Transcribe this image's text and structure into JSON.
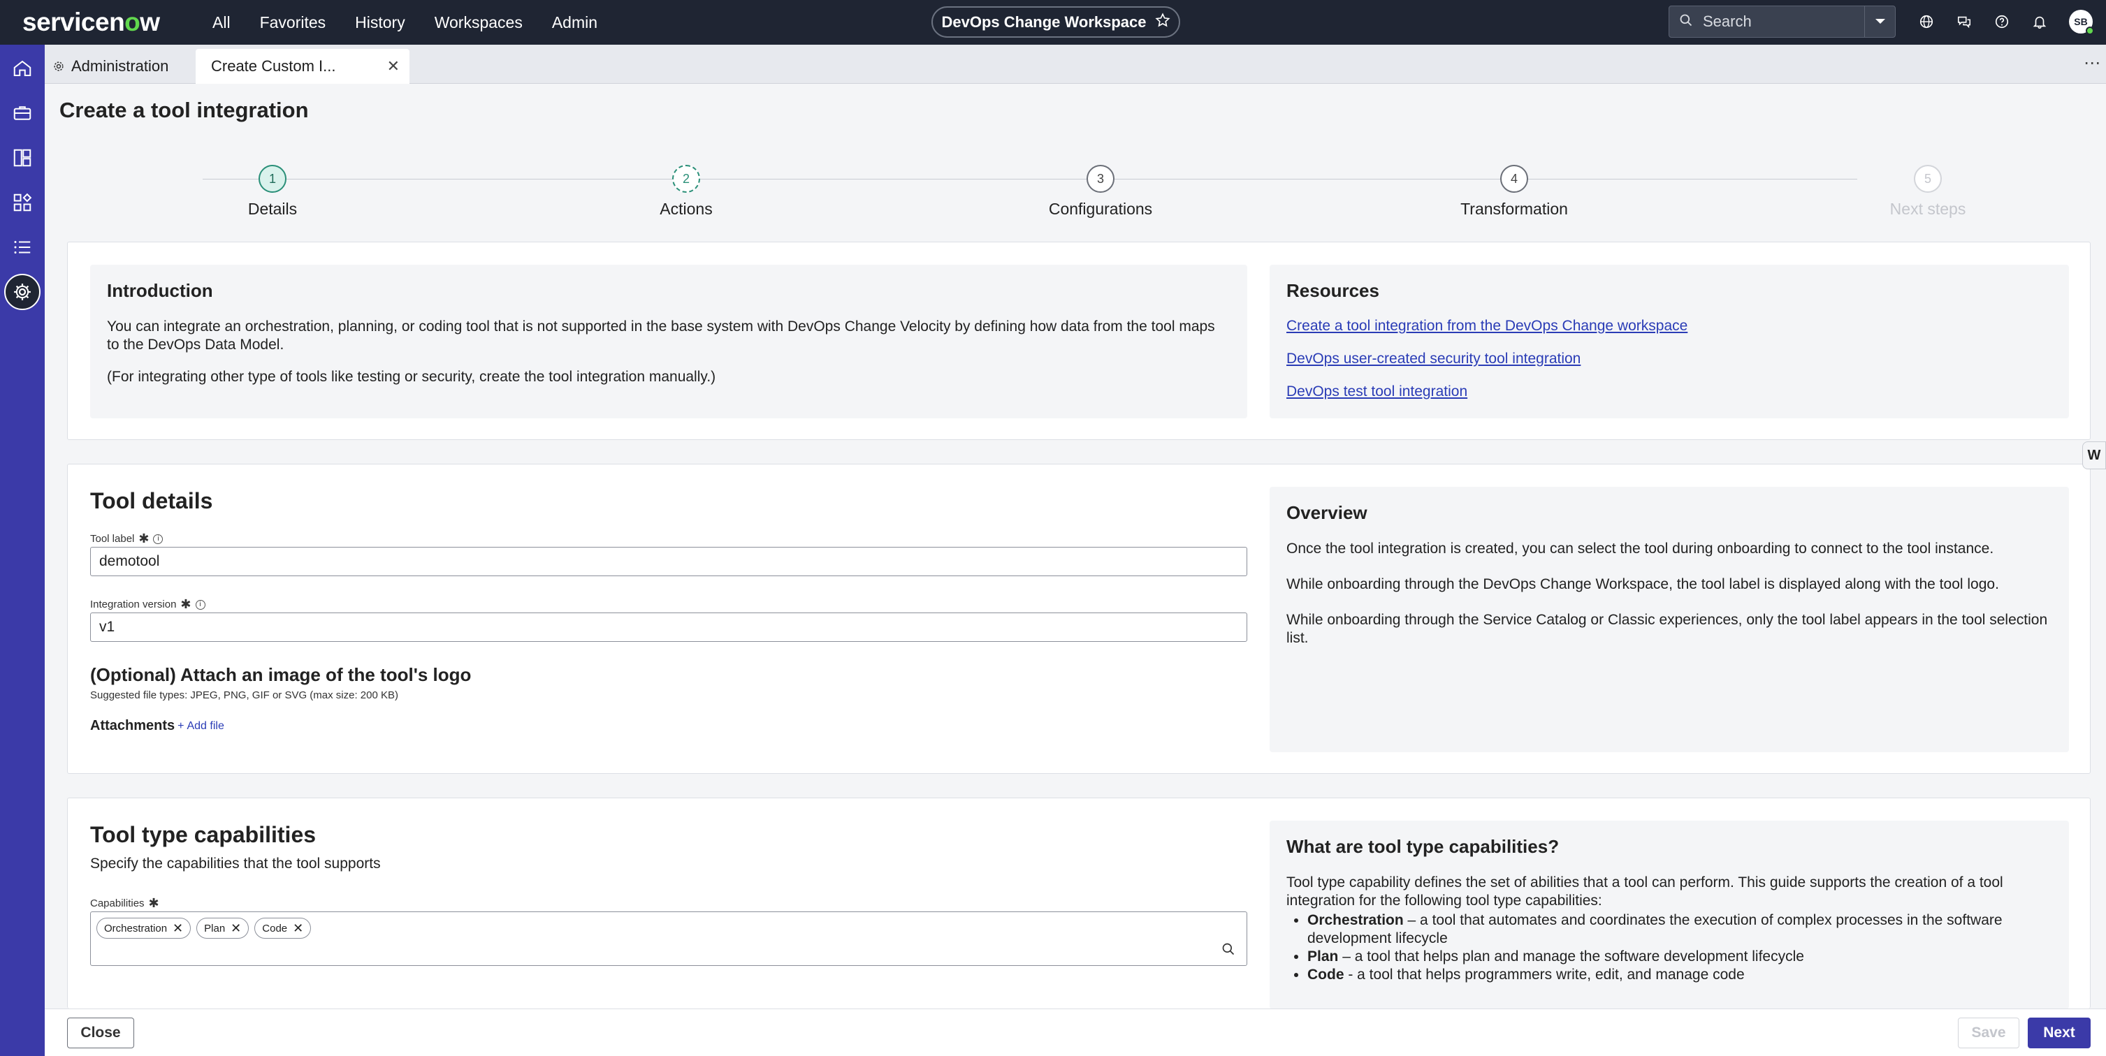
{
  "topbar": {
    "logo_text": "servicenow",
    "nav": [
      "All",
      "Favorites",
      "History",
      "Workspaces",
      "Admin"
    ],
    "workspace_title": "DevOps Change Workspace",
    "search_placeholder": "Search",
    "avatar_initials": "SB"
  },
  "tabs": {
    "admin_label": "Administration",
    "active_label": "Create Custom I..."
  },
  "page": {
    "title": "Create a tool integration"
  },
  "stepper": {
    "steps": [
      {
        "num": "1",
        "label": "Details",
        "state": "current"
      },
      {
        "num": "2",
        "label": "Actions",
        "state": "next"
      },
      {
        "num": "3",
        "label": "Configurations",
        "state": "pending"
      },
      {
        "num": "4",
        "label": "Transformation",
        "state": "pending"
      },
      {
        "num": "5",
        "label": "Next steps",
        "state": "disabled"
      }
    ]
  },
  "intro": {
    "title": "Introduction",
    "para1": "You can integrate an orchestration, planning, or coding tool that is not supported in the base system with DevOps Change Velocity by defining how data from the tool maps to the DevOps Data Model.",
    "para2": "(For integrating other type of tools like testing or security, create the tool integration manually.)"
  },
  "resources": {
    "title": "Resources",
    "links": [
      "Create a tool integration from the DevOps Change workspace",
      "DevOps user-created security tool integration",
      "DevOps test tool integration"
    ]
  },
  "tool_details": {
    "title": "Tool details",
    "tool_label_label": "Tool label",
    "tool_label_value": "demotool",
    "version_label": "Integration version",
    "version_value": "v1",
    "logo_title": "(Optional) Attach an image of the tool's logo",
    "logo_hint": "Suggested file types: JPEG, PNG, GIF or SVG (max size: 200 KB)",
    "attachments_label": "Attachments",
    "add_file_label": "Add file"
  },
  "overview": {
    "title": "Overview",
    "para1": "Once the tool integration is created, you can select the tool during onboarding to connect to the tool instance.",
    "para2": "While onboarding through the DevOps Change Workspace, the tool label is displayed along with the tool logo.",
    "para3": "While onboarding through the Service Catalog or Classic experiences, only the tool label appears in the tool selection list."
  },
  "capabilities": {
    "title": "Tool type capabilities",
    "subtitle": "Specify the capabilities that the tool supports",
    "field_label": "Capabilities",
    "chips": [
      "Orchestration",
      "Plan",
      "Code"
    ]
  },
  "capabilities_help": {
    "title": "What are tool type capabilities?",
    "intro": "Tool type capability defines the set of abilities that a tool can perform. This guide supports the creation of a tool integration for the following tool type capabilities:",
    "items": [
      {
        "term": "Orchestration",
        "desc": " – a tool that automates and coordinates the execution of complex processes in the software development lifecycle"
      },
      {
        "term": "Plan",
        "desc": " – a tool that helps plan and manage the software development lifecycle"
      },
      {
        "term": "Code",
        "desc": " - a tool that helps programmers write, edit, and manage code"
      }
    ]
  },
  "footer": {
    "close_label": "Close",
    "save_label": "Save",
    "next_label": "Next"
  },
  "side_widget_label": "W",
  "colors": {
    "topbar": "#1f2533",
    "sidebar": "#3b3aa8",
    "accent": "#3b3aa8",
    "step_current": "#2a8f78",
    "link": "#2a3cb6"
  }
}
